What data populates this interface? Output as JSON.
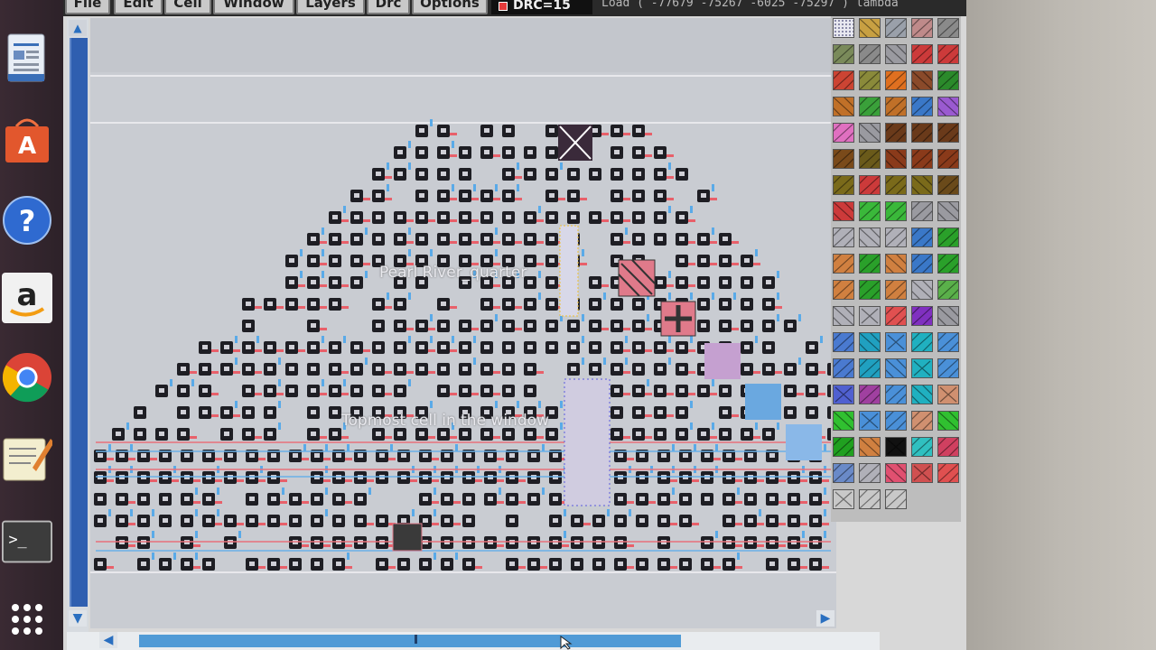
{
  "menubar": {
    "items": [
      {
        "label": "File"
      },
      {
        "label": "Edit"
      },
      {
        "label": "Cell"
      },
      {
        "label": "Window"
      },
      {
        "label": "Layers"
      },
      {
        "label": "Drc"
      },
      {
        "label": "Options"
      }
    ],
    "drc_badge": "DRC=15",
    "coordinate_readout": "Load  ( -77679 -75267 -6025 -75297 ) lambda"
  },
  "canvas": {
    "labels": {
      "pearl_river": "Pearl River_quarter",
      "topmost_cell": "Topmost cell in the window"
    }
  },
  "launcher": {
    "items": [
      {
        "name": "libreoffice-writer-icon",
        "color": "#e8eef6"
      },
      {
        "name": "ubuntu-software-icon",
        "color": "#e2572d"
      },
      {
        "name": "help-icon",
        "color": "#2f6ad0"
      },
      {
        "name": "amazon-icon",
        "color": "#f1f1f1"
      },
      {
        "name": "chrome-icon",
        "color": "#db4437"
      },
      {
        "name": "text-editor-icon",
        "color": "#f3eecf"
      },
      {
        "name": "terminal-icon",
        "color": "#3c3c3c"
      },
      {
        "name": "show-apps-icon",
        "color": "#ffffff"
      }
    ]
  },
  "palette": {
    "columns": 5,
    "swatches": [
      "grid",
      "#c8a042",
      "#9aa0aa",
      "#bf8a8a",
      "#8a8a8a",
      "#7a8a5a",
      "#8a8a8a",
      "#9a9aa0",
      "#cc3a3a",
      "#cc3a3a",
      "#cc4433",
      "#8a8a3a",
      "#e07020",
      "#8a4a2a",
      "#2b8a2b",
      "#c07028",
      "#3aa03a",
      "#c07028",
      "#3a78c8",
      "#9a5ad0",
      "#e070c0",
      "#9a9aa0",
      "#6a3a1a",
      "#6a3a1a",
      "#6a3a1a",
      "#7a4a1a",
      "#6a5a1a",
      "#8a3a1a",
      "#8a3a1a",
      "#8a3a1a",
      "#7a6a1a",
      "#cc3a3a",
      "#7a6a1a",
      "#7a6a1a",
      "#6a4a1a",
      "#cc3a3a",
      "#3ab83a",
      "#3ab83a",
      "#9a9aa0",
      "#9a9aa0",
      "#b0b0b8",
      "#b0b0b8",
      "#b0b0b8",
      "#3a78c8",
      "#2aa02a",
      "#d08040",
      "#2aa02a",
      "#d08040",
      "#3a78c8",
      "#2aa02a",
      "#d08040",
      "#2aa02a",
      "#d08040",
      "#b0b0b8",
      "#5ab04a",
      "#b0b0b8",
      "#b0b0b8",
      "#e05050",
      "#8030c0",
      "#9a9aa0",
      "#4a7ad0",
      "#20a0c0",
      "#4a90d8",
      "#20b0c0",
      "#4a90d8",
      "#4a7ad0",
      "#20a0c0",
      "#4a90d8",
      "#20b0c0",
      "#4a90d8",
      "#5060d0",
      "#a040a0",
      "#4a90d8",
      "#20b0c0",
      "#d09070",
      "#30c030",
      "#4a90d8",
      "#4a90d8",
      "#d09070",
      "#30c030",
      "#20a020",
      "#d08040",
      "#111111",
      "#30c0c0",
      "#d04060",
      "#6a8ac8",
      "#b0b0b8",
      "#e05070",
      "#d05050",
      "#e05050",
      "#c8c8c8",
      "#c8c8c8",
      "#c8c8c8"
    ]
  }
}
